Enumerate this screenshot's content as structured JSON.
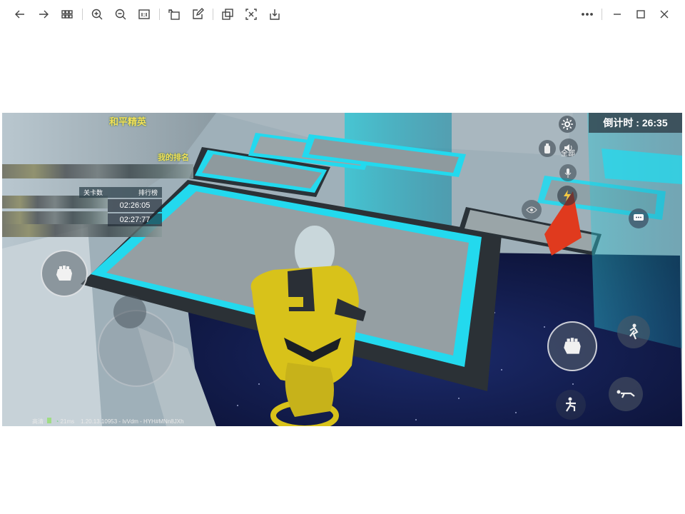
{
  "toolbar": {
    "buttons": [
      {
        "name": "back-icon"
      },
      {
        "name": "forward-icon"
      },
      {
        "name": "grid-view-icon"
      },
      {
        "name": "zoom-in-icon"
      },
      {
        "name": "zoom-out-icon"
      },
      {
        "name": "actual-size-icon"
      },
      {
        "name": "rotate-icon"
      },
      {
        "name": "edit-icon"
      },
      {
        "name": "copy-icon"
      },
      {
        "name": "ocr-text-icon"
      },
      {
        "name": "download-icon"
      }
    ],
    "window": [
      {
        "name": "more-icon"
      },
      {
        "name": "minimize-icon"
      },
      {
        "name": "maximize-icon"
      },
      {
        "name": "close-icon"
      }
    ]
  },
  "game": {
    "countdown_label": "倒计时 : 26:35",
    "top_yellow_title": "和平精英",
    "my_record_label": "我的排名",
    "table_col_level": "关卡数",
    "table_col_rank": "排行榜",
    "times": [
      "02:26:05",
      "02:27:77"
    ],
    "voice_label": "全部",
    "status_quality": "高清",
    "status_ping": "21ms",
    "status_build": "1.20.13.10953 - IvVdm - HYH#MNn8JXh"
  },
  "colors": {
    "accent_cyan": "#23d9ee",
    "floor_gray": "#9aa5a8",
    "suit_yellow": "#d8c21a",
    "flag_red": "#e03a1e"
  }
}
